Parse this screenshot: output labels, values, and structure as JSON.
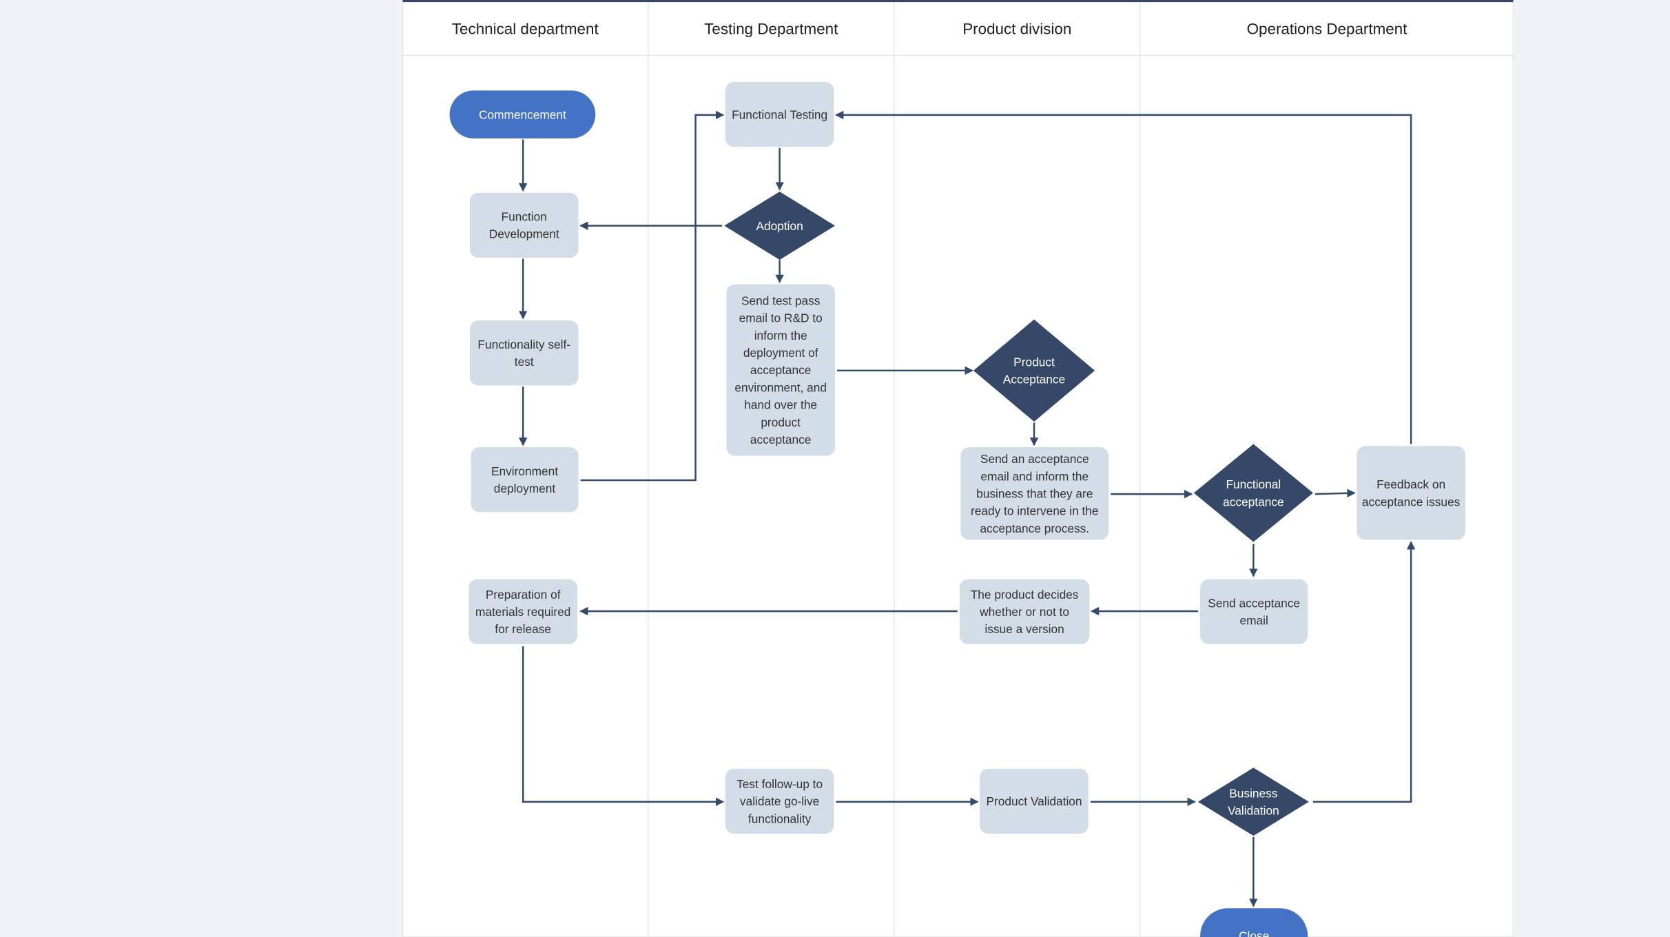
{
  "colors": {
    "terminal": "#4472c4",
    "process": "#d3dde8",
    "decision": "#354868",
    "connector": "#344a6b",
    "lane_divider": "#e3e6ea",
    "background": "#f0f2f5"
  },
  "lanes": [
    {
      "title": "Technical department"
    },
    {
      "title": "Testing Department"
    },
    {
      "title": "Product division"
    },
    {
      "title": "Operations Department"
    }
  ],
  "nodes": [
    {
      "id": "commencement",
      "shape": "terminal",
      "lines": [
        "Commencement"
      ]
    },
    {
      "id": "function-development",
      "shape": "process",
      "lines": [
        "Function",
        "Development"
      ]
    },
    {
      "id": "functionality-self-test",
      "shape": "process",
      "lines": [
        "Functionality self-",
        "test"
      ]
    },
    {
      "id": "environment-deployment",
      "shape": "process",
      "lines": [
        "Environment",
        "deployment"
      ]
    },
    {
      "id": "functional-testing",
      "shape": "process",
      "lines": [
        "Functional Testing"
      ]
    },
    {
      "id": "adoption",
      "shape": "decision",
      "lines": [
        "Adoption"
      ]
    },
    {
      "id": "send-test-pass-email",
      "shape": "process",
      "lines": [
        "Send test pass",
        "email to R&D to",
        "inform the",
        "deployment of",
        "acceptance",
        "environment, and",
        "hand over the",
        "product",
        "acceptance"
      ]
    },
    {
      "id": "product-acceptance",
      "shape": "decision",
      "lines": [
        "Product",
        "Acceptance"
      ]
    },
    {
      "id": "send-acceptance-email-inform",
      "shape": "process",
      "lines": [
        "Send an acceptance",
        "email and inform the",
        "business that they are",
        "ready to intervene in the",
        "acceptance process."
      ]
    },
    {
      "id": "functional-acceptance",
      "shape": "decision",
      "lines": [
        "Functional",
        "acceptance"
      ]
    },
    {
      "id": "feedback-acceptance-issues",
      "shape": "process",
      "lines": [
        "Feedback on",
        "acceptance issues"
      ]
    },
    {
      "id": "send-acceptance-email",
      "shape": "process",
      "lines": [
        "Send acceptance",
        "email"
      ]
    },
    {
      "id": "product-decides-version",
      "shape": "process",
      "lines": [
        "The product decides",
        "whether or not to",
        "issue a version"
      ]
    },
    {
      "id": "preparation-materials-release",
      "shape": "process",
      "lines": [
        "Preparation of",
        "materials required",
        "for release"
      ]
    },
    {
      "id": "test-follow-up",
      "shape": "process",
      "lines": [
        "Test follow-up to",
        "validate go-live",
        "functionality"
      ]
    },
    {
      "id": "product-validation",
      "shape": "process",
      "lines": [
        "Product Validation"
      ]
    },
    {
      "id": "business-validation",
      "shape": "decision",
      "lines": [
        "Business",
        "Validation"
      ]
    },
    {
      "id": "close",
      "shape": "terminal",
      "lines": [
        "Close"
      ]
    }
  ],
  "edges": [
    {
      "from": "commencement",
      "to": "function-development"
    },
    {
      "from": "function-development",
      "to": "functionality-self-test"
    },
    {
      "from": "functionality-self-test",
      "to": "environment-deployment"
    },
    {
      "from": "environment-deployment",
      "to": "functional-testing"
    },
    {
      "from": "functional-testing",
      "to": "adoption"
    },
    {
      "from": "adoption",
      "to": "function-development"
    },
    {
      "from": "adoption",
      "to": "send-test-pass-email"
    },
    {
      "from": "send-test-pass-email",
      "to": "product-acceptance"
    },
    {
      "from": "product-acceptance",
      "to": "send-acceptance-email-inform"
    },
    {
      "from": "send-acceptance-email-inform",
      "to": "functional-acceptance"
    },
    {
      "from": "functional-acceptance",
      "to": "feedback-acceptance-issues"
    },
    {
      "from": "feedback-acceptance-issues",
      "to": "functional-testing"
    },
    {
      "from": "functional-acceptance",
      "to": "send-acceptance-email"
    },
    {
      "from": "send-acceptance-email",
      "to": "product-decides-version"
    },
    {
      "from": "product-decides-version",
      "to": "preparation-materials-release"
    },
    {
      "from": "preparation-materials-release",
      "to": "test-follow-up"
    },
    {
      "from": "test-follow-up",
      "to": "product-validation"
    },
    {
      "from": "product-validation",
      "to": "business-validation"
    },
    {
      "from": "business-validation",
      "to": "feedback-acceptance-issues"
    },
    {
      "from": "business-validation",
      "to": "close"
    }
  ]
}
